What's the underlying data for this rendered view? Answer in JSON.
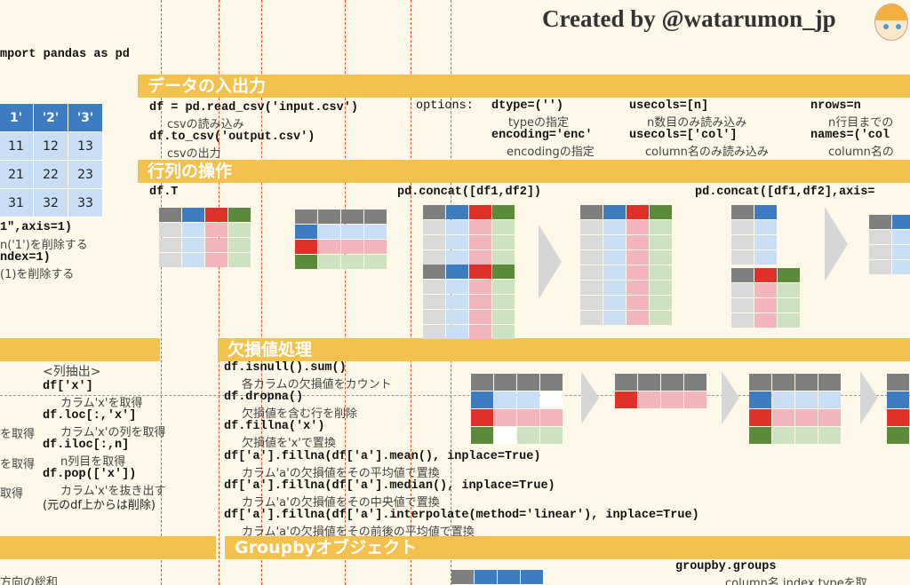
{
  "header": {
    "title": "Created by @watarumon_jp"
  },
  "import": {
    "code": "mport pandas as pd"
  },
  "sections": {
    "io": "データの入出力",
    "matrix": "行列の操作",
    "missing": "欠損値処理",
    "groupby": "Groupbyオブジェクト"
  },
  "left_table": {
    "headers": [
      "1'",
      "'2'",
      "'3'"
    ],
    "rows": [
      [
        "11",
        "12",
        "13"
      ],
      [
        "21",
        "22",
        "23"
      ],
      [
        "31",
        "32",
        "33"
      ]
    ]
  },
  "left_notes": {
    "drop_col_code": "1\",axis=1)",
    "drop_col_desc": "n('1')を削除する",
    "drop_idx_code": "ndex=1)",
    "drop_idx_desc": "(1)を削除する",
    "get1": "を取得",
    "get2": "を取得",
    "get3": "取得",
    "bottom": "方向の総和"
  },
  "io": {
    "read_code": "df = pd.read_csv('input.csv')",
    "read_desc": "csvの読み込み",
    "write_code": "df.to_csv('output.csv')",
    "write_desc": "csvの出力",
    "options_label": "options:",
    "dtype_code": "dtype=('')",
    "dtype_desc": "typeの指定",
    "encoding_code": "encoding='enc'",
    "encoding_desc": "encodingの指定",
    "usecols_n_code": "usecols=[n]",
    "usecols_n_desc": "n数目のみ読み込み",
    "usecols_col_code": "usecols=['col']",
    "usecols_col_desc": "column名のみ読み込み",
    "nrows_code": "nrows=n",
    "nrows_desc": "n行目までの",
    "names_code": "names=('col",
    "names_desc": "column名の"
  },
  "matrix": {
    "transpose_code": "df.T",
    "concat_code": "pd.concat([df1,df2])",
    "concat_axis_code": "pd.concat([df1,df2],axis="
  },
  "select": {
    "heading": "<列抽出>",
    "col_code": "df['x']",
    "col_desc": "カラム'x'を取得",
    "loc_code": "df.loc[:,'x']",
    "loc_desc": "カラム'x'の列を取得",
    "iloc_code": "df.iloc[:,n]",
    "iloc_desc": "n列目を取得",
    "pop_code": "df.pop(['x'])",
    "pop_desc": "カラム'x'を抜き出す",
    "pop_note": "(元のdf上からは削除)"
  },
  "missing": {
    "isnull_code": "df.isnull().sum()",
    "isnull_desc": "各カラムの欠損値をカウント",
    "dropna_code": "df.dropna()",
    "dropna_desc": "欠損値を含む行を削除",
    "fillna_code": "df.fillna('x')",
    "fillna_desc": "欠損値を'x'で置換",
    "mean_code": "df['a'].fillna(df['a'].mean(), inplace=True)",
    "mean_desc": "カラム'a'の欠損値をその平均値で置換",
    "median_code": "df['a'].fillna(df['a'].median(), inplace=True)",
    "median_desc": "カラム'a'の欠損値をその中央値で置換",
    "interp_code": "df['a'].fillna(df['a'].interpolate(method='linear'), inplace=True)",
    "interp_desc": "カラム'a'の欠損値をその前後の平均値で置換"
  },
  "groupby": {
    "groups_code": "groupby.groups",
    "groups_desc": "column名.index.typeを取"
  },
  "colors": {
    "band": "#f2c14e",
    "grey": "#7f7f7f",
    "blue": "#3e7cc2",
    "red": "#e0302a",
    "green": "#5a8a3a",
    "light_grey": "#d9d9d9",
    "light_blue": "#c9def4",
    "light_red": "#f2b5bb",
    "light_green": "#cde2c0"
  }
}
